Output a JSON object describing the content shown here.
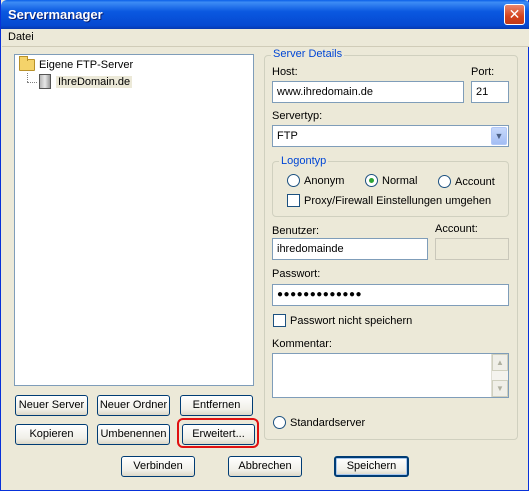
{
  "window": {
    "title": "Servermanager"
  },
  "menu": {
    "file": "Datei"
  },
  "tree": {
    "root_label": "Eigene FTP-Server",
    "child_label": "IhreDomain.de"
  },
  "left_buttons": {
    "new_server": "Neuer Server",
    "new_folder": "Neuer Ordner",
    "remove": "Entfernen",
    "copy": "Kopieren",
    "rename": "Umbenennen",
    "advanced": "Erweitert..."
  },
  "details": {
    "legend": "Server Details",
    "host_label": "Host:",
    "host_value": "www.ihredomain.de",
    "port_label": "Port:",
    "port_value": "21",
    "servertype_label": "Servertyp:",
    "servertype_value": "FTP",
    "logon": {
      "legend": "Logontyp",
      "anon": "Anonym",
      "normal": "Normal",
      "account": "Account",
      "proxy_bypass": "Proxy/Firewall Einstellungen umgehen",
      "selected": "normal"
    },
    "user_label": "Benutzer:",
    "user_value": "ihredomainde",
    "account_label": "Account:",
    "account_value": "",
    "password_label": "Passwort:",
    "password_value": "●●●●●●●●●●●●●",
    "no_save_password": "Passwort nicht speichern",
    "comment_label": "Kommentar:",
    "comment_value": "",
    "default_server": "Standardserver"
  },
  "bottom_buttons": {
    "connect": "Verbinden",
    "cancel": "Abbrechen",
    "save": "Speichern"
  },
  "colors": {
    "titlebar": "#0549d1",
    "group_legend": "#0046d5",
    "highlight": "#e01010"
  }
}
